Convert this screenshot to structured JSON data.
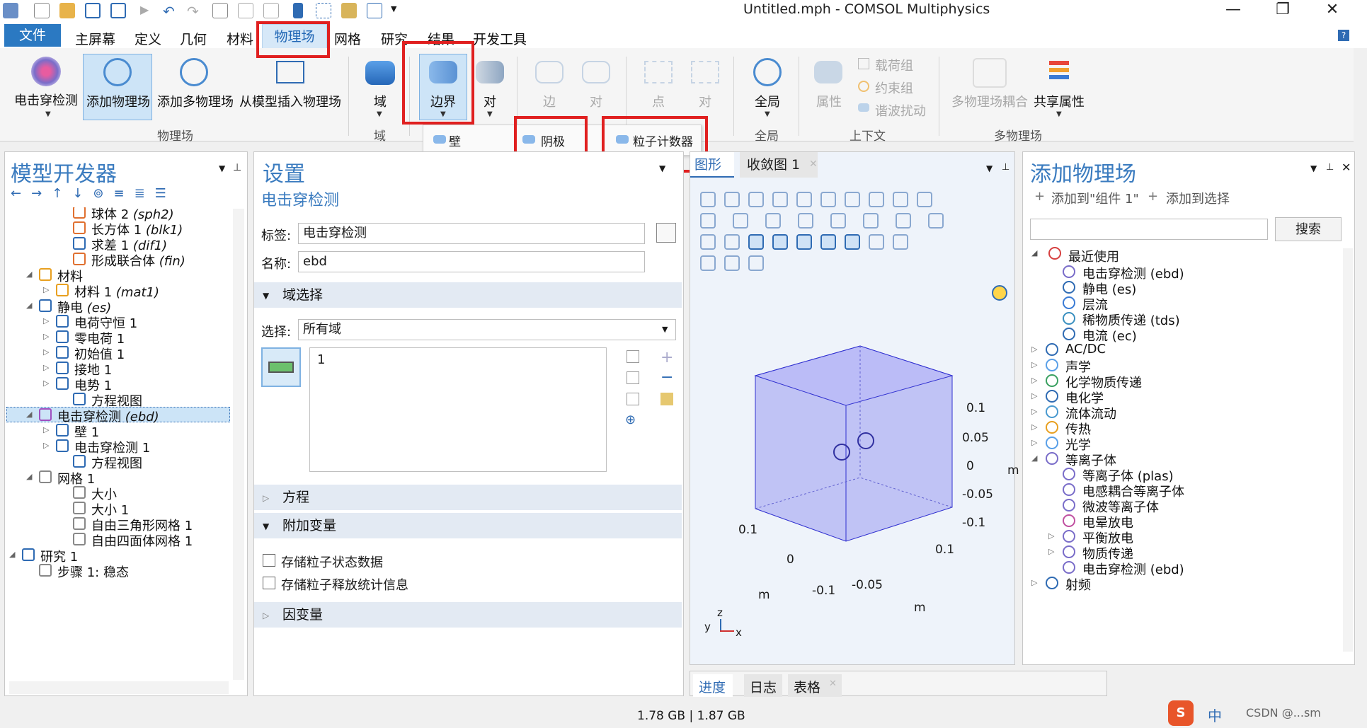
{
  "window": {
    "title": "Untitled.mph - COMSOL Multiphysics",
    "minimize": "—",
    "maximize": "❐",
    "close": "✕"
  },
  "menu": {
    "file": "文件",
    "items": [
      "主屏幕",
      "定义",
      "几何",
      "材料",
      "物理场",
      "网格",
      "研究",
      "结果",
      "开发工具"
    ],
    "help": "?"
  },
  "ribbon": {
    "physics_group": {
      "label": "物理场",
      "buttons": [
        "电击穿检测",
        "添加物理场",
        "添加多物理场",
        "从模型插入物理场"
      ]
    },
    "domain_group": {
      "label": "域",
      "button": "域"
    },
    "boundary_group": {
      "label": "边界",
      "buttons": [
        "边界",
        "对"
      ]
    },
    "edge_group": {
      "label": "边",
      "buttons": [
        "边",
        "对"
      ]
    },
    "point_group": {
      "label": "点",
      "buttons": [
        "点",
        "对"
      ]
    },
    "global_group": {
      "label": "全局",
      "button": "全局"
    },
    "context_group": {
      "label": "上下文",
      "buttons": [
        "属性",
        "载荷组",
        "约束组",
        "谐波扰动"
      ]
    },
    "multiphysics_group": {
      "label": "多物理场",
      "buttons": [
        "多物理场耦合",
        "共享属性"
      ]
    }
  },
  "dropdown": {
    "items": [
      "壁",
      "阴极",
      "粒子计数器"
    ]
  },
  "model_builder": {
    "title": "模型开发器",
    "tree": [
      {
        "text": "球体 2 ",
        "italic": "(sph2)"
      },
      {
        "text": "长方体 1 ",
        "italic": "(blk1)"
      },
      {
        "text": "求差 1 ",
        "italic": "(dif1)"
      },
      {
        "text": "形成联合体 ",
        "italic": "(fin)"
      },
      {
        "text": "材料",
        "italic": ""
      },
      {
        "text": "材料 1 ",
        "italic": "(mat1)"
      },
      {
        "text": "静电 ",
        "italic": "(es)"
      },
      {
        "text": "电荷守恒 1",
        "italic": ""
      },
      {
        "text": "零电荷 1",
        "italic": ""
      },
      {
        "text": "初始值 1",
        "italic": ""
      },
      {
        "text": "接地 1",
        "italic": ""
      },
      {
        "text": "电势 1",
        "italic": ""
      },
      {
        "text": "方程视图",
        "italic": ""
      },
      {
        "text": "电击穿检测 ",
        "italic": "(ebd)"
      },
      {
        "text": "壁 1",
        "italic": ""
      },
      {
        "text": "电击穿检测 1",
        "italic": ""
      },
      {
        "text": "方程视图",
        "italic": ""
      },
      {
        "text": "网格 1",
        "italic": ""
      },
      {
        "text": "大小",
        "italic": ""
      },
      {
        "text": "大小 1",
        "italic": ""
      },
      {
        "text": "自由三角形网格 1",
        "italic": ""
      },
      {
        "text": "自由四面体网格 1",
        "italic": ""
      },
      {
        "text": "研究 1",
        "italic": ""
      },
      {
        "text": "步骤 1: 稳态",
        "italic": ""
      }
    ]
  },
  "settings": {
    "title": "设置",
    "subtitle": "电击穿检测",
    "label_label": "标签:",
    "label_value": "电击穿检测",
    "name_label": "名称:",
    "name_value": "ebd",
    "domain_selection": "域选择",
    "selection_label": "选择:",
    "selection_value": "所有域",
    "list_item": "1",
    "equation": "方程",
    "extra_vars": "附加变量",
    "chk1": "存储粒子状态数据",
    "chk2": "存储粒子释放统计信息",
    "dependent_vars": "因变量"
  },
  "graphics": {
    "tab_graphics": "图形",
    "tab_convergence": "收敛图 1",
    "axis_labels": [
      "0.1",
      "0.05",
      "0",
      "-0.05",
      "-0.1",
      "0.1",
      "0",
      "m",
      "-0.1",
      "-0.05",
      "m",
      "0.1",
      "m"
    ],
    "triad": {
      "x": "x",
      "y": "y",
      "z": "z"
    }
  },
  "add_physics": {
    "title": "添加物理场",
    "add_to_component": "添加到\"组件 1\"",
    "add_to_selection": "添加到选择",
    "search_button": "搜索",
    "recent": "最近使用",
    "tree": [
      {
        "text": "电击穿检测 (ebd)",
        "indent": 2
      },
      {
        "text": "静电 (es)",
        "indent": 2
      },
      {
        "text": "层流",
        "indent": 2
      },
      {
        "text": "稀物质传递 (tds)",
        "indent": 2
      },
      {
        "text": "电流 (ec)",
        "indent": 2
      },
      {
        "text": "AC/DC",
        "indent": 1
      },
      {
        "text": "声学",
        "indent": 1
      },
      {
        "text": "化学物质传递",
        "indent": 1
      },
      {
        "text": "电化学",
        "indent": 1
      },
      {
        "text": "流体流动",
        "indent": 1
      },
      {
        "text": "传热",
        "indent": 1
      },
      {
        "text": "光学",
        "indent": 1
      },
      {
        "text": "等离子体",
        "indent": 1
      },
      {
        "text": "等离子体 (plas)",
        "indent": 2
      },
      {
        "text": "电感耦合等离子体",
        "indent": 2
      },
      {
        "text": "微波等离子体",
        "indent": 2
      },
      {
        "text": "电晕放电",
        "indent": 2
      },
      {
        "text": "平衡放电",
        "indent": 2
      },
      {
        "text": "物质传递",
        "indent": 2
      },
      {
        "text": "电击穿检测 (ebd)",
        "indent": 2
      },
      {
        "text": "射频",
        "indent": 1
      }
    ]
  },
  "bottom_tabs": [
    "进度",
    "日志",
    "表格"
  ],
  "status": {
    "memory": "1.78 GB | 1.87 GB",
    "ime": "中",
    "watermark": "CSDN @...sm"
  },
  "colors": {
    "accent": "#2b79c2",
    "highlight_box": "#e02020",
    "selected_row": "#cce4f7",
    "section_header": "#e3eaf3"
  }
}
